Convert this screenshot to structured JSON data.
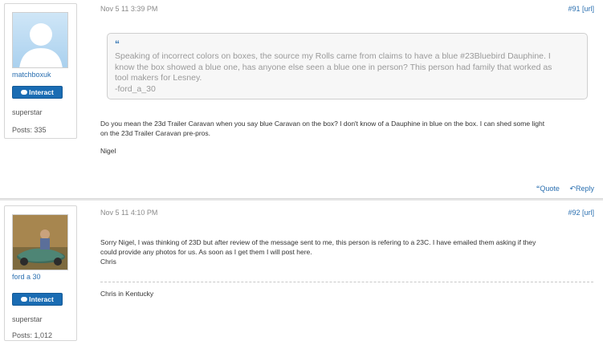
{
  "posts": [
    {
      "user": {
        "username": "matchboxuk",
        "interact_label": "Interact",
        "role": "superstar",
        "posts_label": "Posts: 335"
      },
      "date": "Nov 5 11 3:39 PM",
      "post_number": "#91",
      "url_label": "[url]",
      "quote": {
        "mark": "“",
        "lines": [
          "Speaking of incorrect colors on boxes, the source my Rolls came from claims to have a blue #23Bluebird  Dauphine.  I",
          "know the box showed a blue one, has anyone else seen a blue one in person?  This person had family that worked as",
          "tool makers for Lesney.",
          "-ford_a_30"
        ]
      },
      "body_lines": [
        "Do you mean the 23d Trailer Caravan when you say blue Caravan on the box? I don't know of a Dauphine in blue on the box. I can shed some light",
        "on the 23d Trailer Caravan pre-pros."
      ],
      "body_sign": "Nigel",
      "actions": {
        "quote_label": "Quote",
        "reply_label": "Reply"
      }
    },
    {
      "user": {
        "username": "ford a 30",
        "interact_label": "Interact",
        "role": "superstar",
        "posts_label": "Posts: 1,012"
      },
      "date": "Nov 5 11 4:10 PM",
      "post_number": "#92",
      "url_label": "[url]",
      "body_lines": [
        "Sorry Nigel, I was thinking of 23D but after review of the message sent to me, this person is refering to a 23C.  I have emailed them asking if they",
        "could provide any photos for us.  As soon as I get them I will post here.",
        "Chris"
      ],
      "signature": "Chris in Kentucky"
    }
  ],
  "colors": {
    "link": "#2a6fb0",
    "button": "#1a6cb3",
    "quote_text": "#9a9a9a",
    "meta_text": "#8a8a8a"
  }
}
